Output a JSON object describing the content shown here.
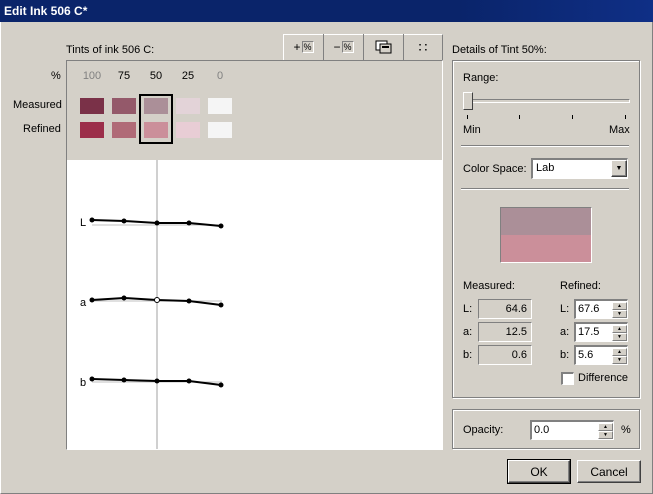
{
  "window": {
    "title": "Edit Ink 506 C*"
  },
  "tints_panel": {
    "title": "Tints of ink 506 C:",
    "percent_symbol": "%",
    "percent_labels": [
      "100",
      "75",
      "50",
      "25",
      "0"
    ],
    "measured_label": "Measured",
    "refined_label": "Refined",
    "measured_colors": [
      "#7a3148",
      "#94596a",
      "#ab8f98",
      "#e3d3d8",
      "#f5f5f5"
    ],
    "refined_colors": [
      "#9c2e4a",
      "#b06a77",
      "#cb8f9a",
      "#e8cdd5",
      "#f5f5f5"
    ],
    "selected_index": 2,
    "toolbar": {
      "add_tint_label": "+",
      "remove_tint_label": "−",
      "percent_glyph": "%",
      "dots_glyph": "∷"
    },
    "graph_labels": [
      "L",
      "a",
      "b"
    ]
  },
  "details": {
    "title": "Details of Tint 50%:",
    "range_label": "Range:",
    "range_min": "Min",
    "range_max": "Max",
    "range_value": 0.0,
    "color_space_label": "Color Space:",
    "color_space_value": "Lab",
    "preview_measured_color": "#ab8f98",
    "preview_refined_color": "#cb8f9a",
    "measured_label": "Measured:",
    "refined_label": "Refined:",
    "L_label": "L:",
    "a_label": "a:",
    "b_label": "b:",
    "measured": {
      "L": "64.6",
      "a": "12.5",
      "b": "0.6"
    },
    "refined": {
      "L": "67.6",
      "a": "17.5",
      "b": "5.6"
    },
    "difference_label": "Difference",
    "difference_checked": false
  },
  "opacity": {
    "label": "Opacity:",
    "value": "0.0",
    "unit": "%"
  },
  "buttons": {
    "ok": "OK",
    "cancel": "Cancel"
  }
}
